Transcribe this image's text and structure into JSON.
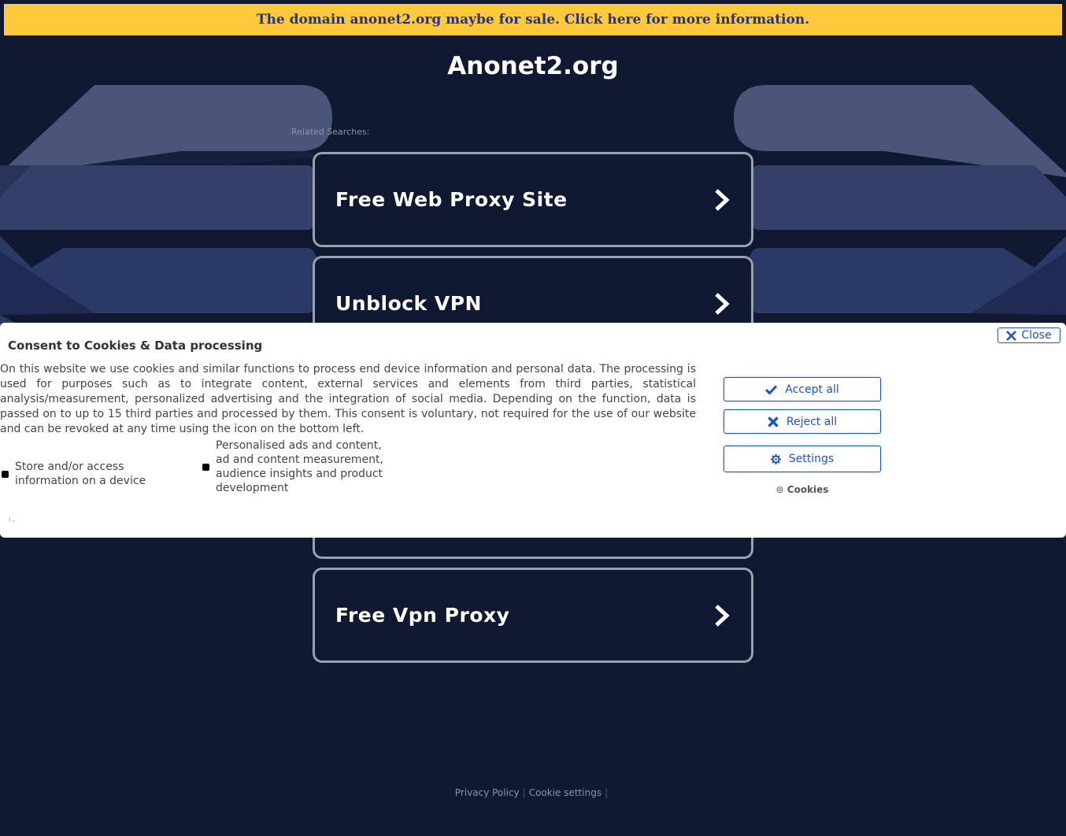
{
  "banner": {
    "text": "The domain anonet2.org maybe for sale. Click here for more information."
  },
  "site": {
    "title": "Anonet2.org"
  },
  "related": {
    "label": "Related Searches:",
    "items": [
      {
        "label": "Free Web Proxy Site"
      },
      {
        "label": "Unblock VPN"
      },
      {
        "label": ""
      },
      {
        "label": "Free Vpn Proxy"
      }
    ]
  },
  "consent": {
    "title": "Consent to Cookies & Data processing",
    "close_label": "Close",
    "text": "On this website we use cookies and similar functions to process end device information and personal data. The processing is used for purposes such as to integrate content, external services and elements from third parties, statistical analysis/measurement, personalized advertising and the integration of social media. Depending on the function, data is passed on to up to 15 third parties and processed by them. This consent is voluntary, not required for the use of our website and can be revoked at any time using the icon on the bottom left.",
    "purposes": [
      {
        "label": "Store and/or access information on a device"
      },
      {
        "label": "Personalised ads and content, ad and content measurement, audience insights and product development"
      }
    ],
    "accept_label": "Accept all",
    "reject_label": "Reject all",
    "settings_label": "Settings",
    "cookies_label": "Cookies",
    "accent_color": "#1a55c2"
  },
  "footer": {
    "privacy_label": "Privacy Policy",
    "cookie_settings_label": "Cookie settings"
  },
  "colors": {
    "background": "#111831",
    "banner": "#ffc93c",
    "banner_text": "#23338c"
  }
}
